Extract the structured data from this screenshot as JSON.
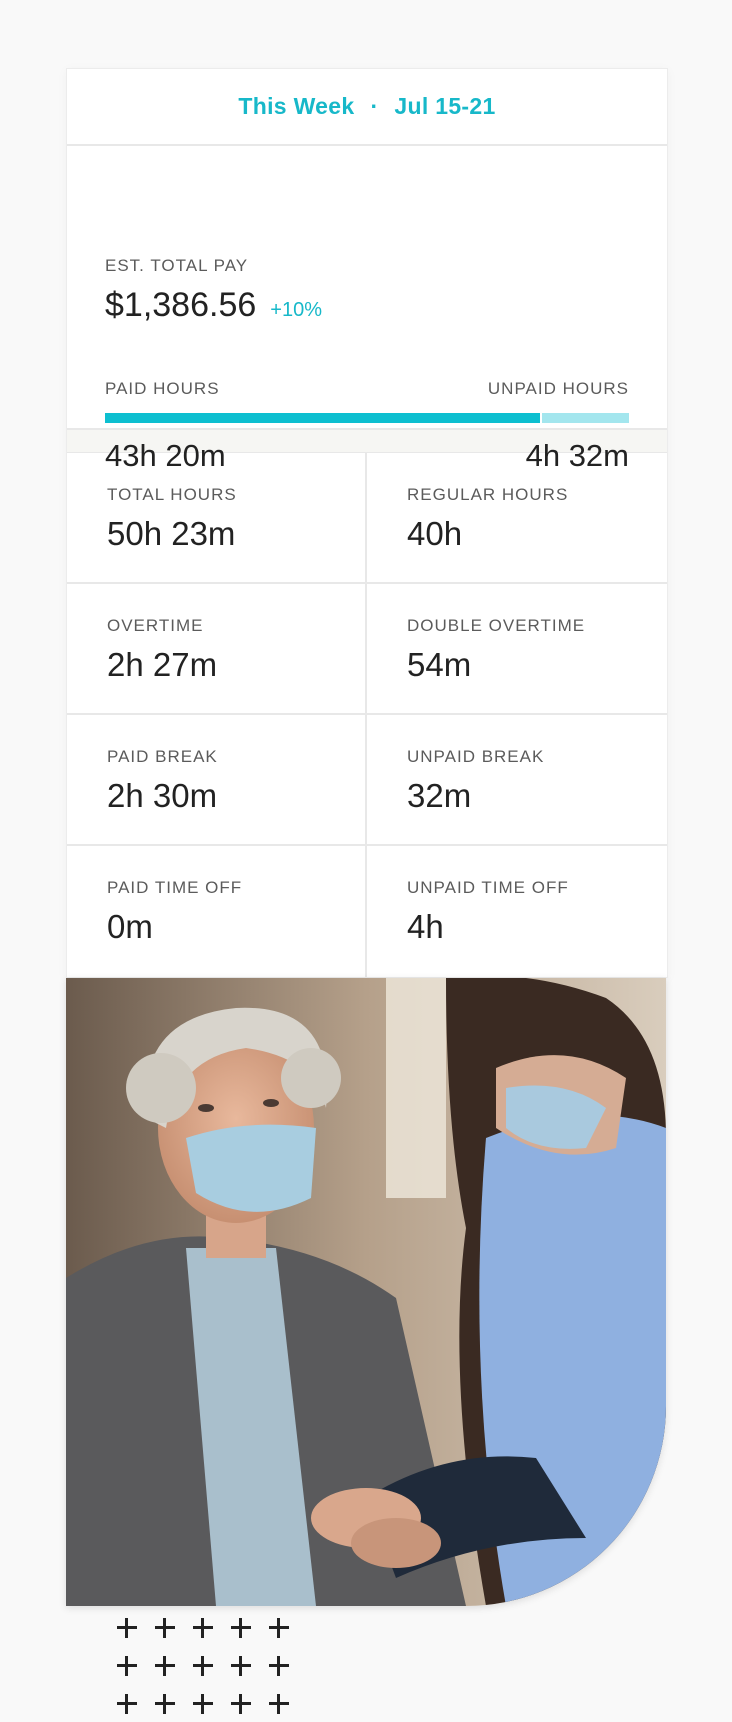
{
  "header": {
    "period_label": "This Week",
    "separator": "·",
    "date_range": "Jul 15-21"
  },
  "pay": {
    "label": "EST. TOTAL PAY",
    "amount": "$1,386.56",
    "change": "+10%"
  },
  "hours": {
    "paid_label": "PAID HOURS",
    "unpaid_label": "UNPAID HOURS",
    "paid_value": "43h 20m",
    "unpaid_value": "4h 32m",
    "paid_fraction": 0.83
  },
  "stats": [
    {
      "label": "TOTAL HOURS",
      "value": "50h 23m"
    },
    {
      "label": "REGULAR HOURS",
      "value": "40h"
    },
    {
      "label": "OVERTIME",
      "value": "2h 27m"
    },
    {
      "label": "DOUBLE OVERTIME",
      "value": "54m"
    },
    {
      "label": "PAID BREAK",
      "value": "2h 30m"
    },
    {
      "label": "UNPAID BREAK",
      "value": "32m"
    },
    {
      "label": "PAID TIME OFF",
      "value": "0m"
    },
    {
      "label": "UNPAID TIME OFF",
      "value": "4h"
    }
  ],
  "colors": {
    "accent": "#17b8c9",
    "bar_paid": "#0dbfd0",
    "bar_unpaid": "#a3e6ee"
  },
  "decor": {
    "photo": "caregiver-holding-hands-with-senior-woman",
    "pattern": "plus-icon-grid"
  }
}
